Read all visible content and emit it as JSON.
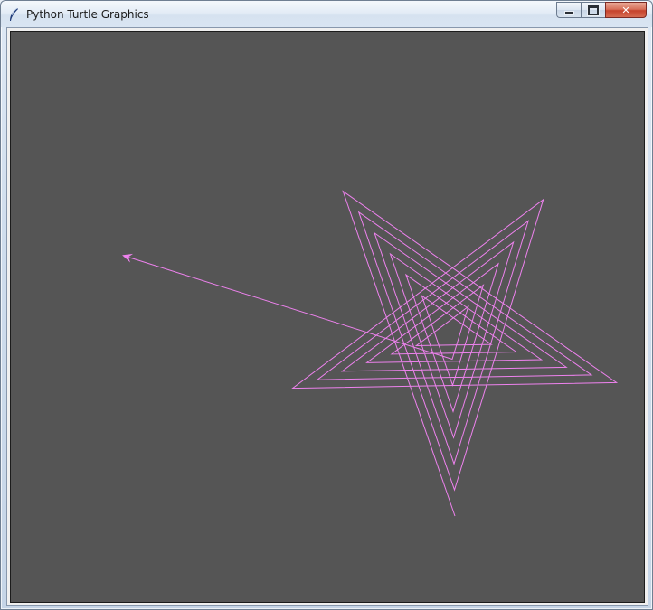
{
  "window": {
    "title": "Python Turtle Graphics",
    "icon": "feather-icon",
    "controls": {
      "minimize": "minimize-icon",
      "maximize": "maximize-icon",
      "close": "close-icon"
    }
  },
  "canvas": {
    "background": "#555555",
    "pen_color": "#ee82ee",
    "turtle_shape": "arrow"
  },
  "drawing": {
    "figure": "spiral-star",
    "stars": 6,
    "angle_deg": 144
  }
}
